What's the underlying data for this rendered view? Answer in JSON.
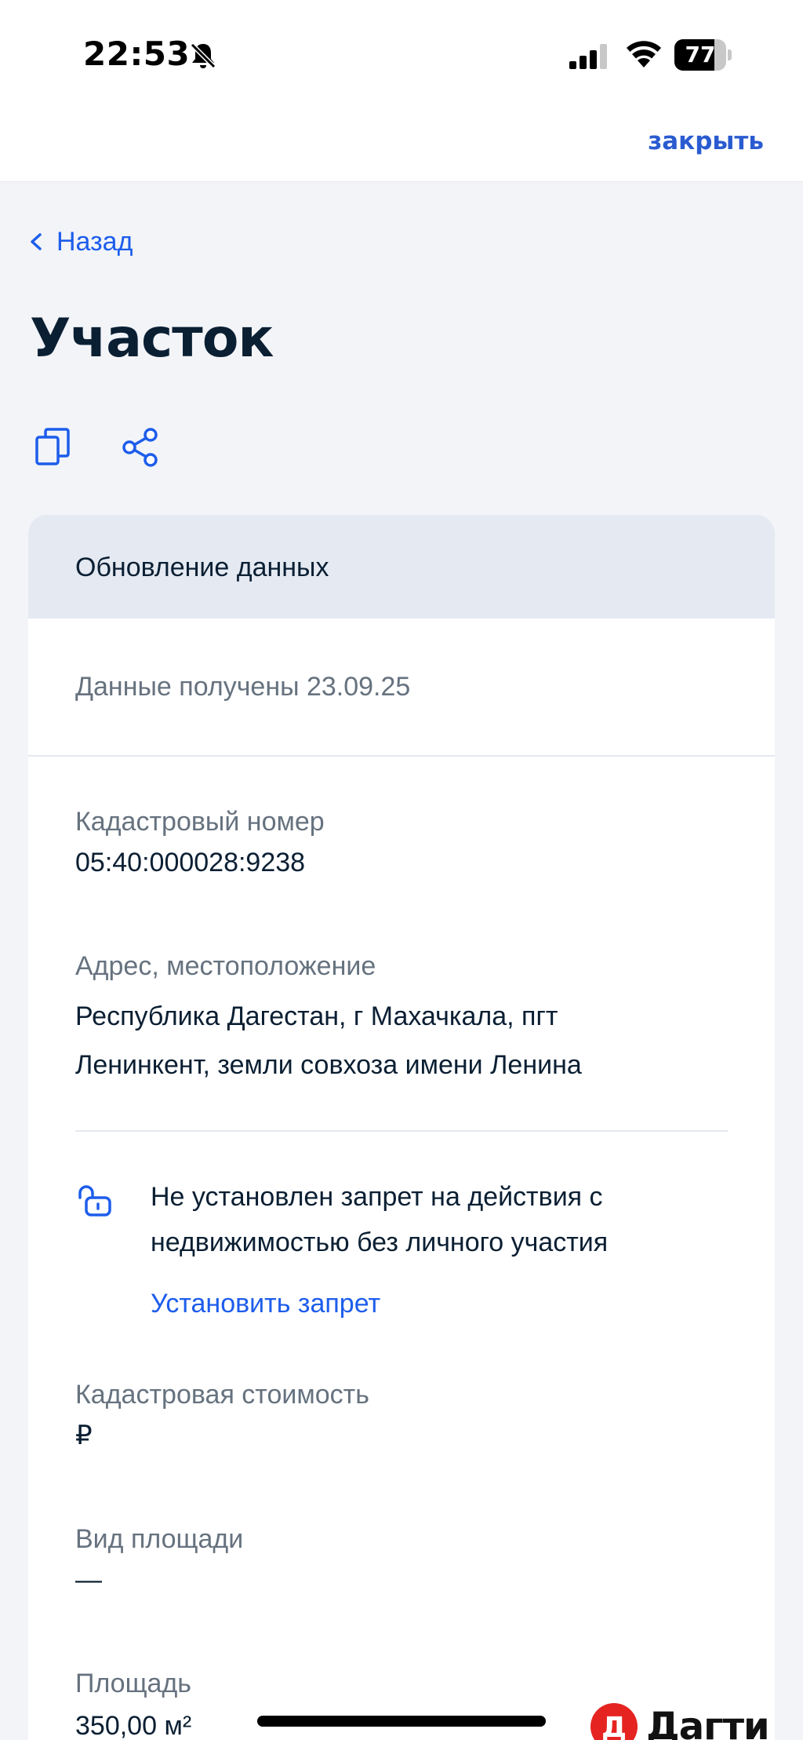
{
  "status_bar": {
    "time": "22:53",
    "battery_level": "77",
    "battery_fraction": 0.77
  },
  "header": {
    "close_label": "закрыть"
  },
  "nav": {
    "back_label": "Назад"
  },
  "page": {
    "title": "Участок"
  },
  "toolbar": {
    "icons": [
      "copy-icon",
      "share-icon"
    ]
  },
  "card": {
    "header_title": "Обновление данных",
    "received": "Данные получены 23.09.25",
    "cadastral_label": "Кадастровый номер",
    "cadastral_value": "05:40:000028:9238",
    "address_label": "Адрес, местоположение",
    "address_line1": "Республика Дагестан, г Махачкала, пгт",
    "address_line2": "Ленинкент, земли совхоза имени Ленина",
    "notice_line1": "Не установлен запрет на действия с",
    "notice_line2": "недвижимостью без личного участия",
    "set_ban_label": "Установить запрет",
    "cost_label": "Кадастровая стоимость",
    "cost_value": "₽",
    "area_type_label": "Вид площади",
    "area_type_value": "—",
    "area_label": "Площадь",
    "area_value": "350,00 м²"
  },
  "watermark": {
    "logo_letter": "Д",
    "text": "Дагти"
  },
  "colors": {
    "accent": "#1d5deb",
    "close_link": "#2a5bd0",
    "text_primary": "#0b1f33",
    "text_secondary": "#66727f",
    "card_header_bg": "#e4e9f2",
    "page_bg": "#f2f4f8",
    "watermark_red": "#e52421"
  }
}
